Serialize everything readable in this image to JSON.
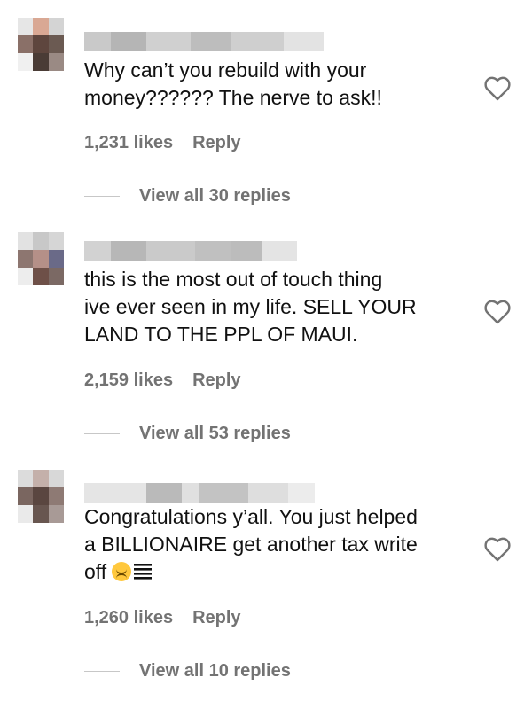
{
  "comments": [
    {
      "lines": [
        "Why can’t you rebuild with your",
        "money?????? The nerve to ask!!"
      ],
      "likes": "1,231 likes",
      "reply_label": "Reply",
      "view_replies": "View all 30 replies"
    },
    {
      "lines": [
        "this is the most out of touch thing",
        "ive ever seen in my life. SELL YOUR",
        "LAND TO THE PPL OF MAUI."
      ],
      "likes": "2,159 likes",
      "reply_label": "Reply",
      "view_replies": "View all 53 replies"
    },
    {
      "lines": [
        "Congratulations y’all. You just helped",
        "a BILLIONAIRE get another tax write",
        "off"
      ],
      "likes": "1,260 likes",
      "reply_label": "Reply",
      "view_replies": "View all 10 replies",
      "trailing_icons": [
        "upside-down-face-emoji",
        "heavy-bars-emoji"
      ]
    }
  ],
  "icons": {
    "heart": "heart-outline-icon"
  },
  "colors": {
    "text": "#111111",
    "secondary": "#737373",
    "divider": "#c7c7c7"
  }
}
